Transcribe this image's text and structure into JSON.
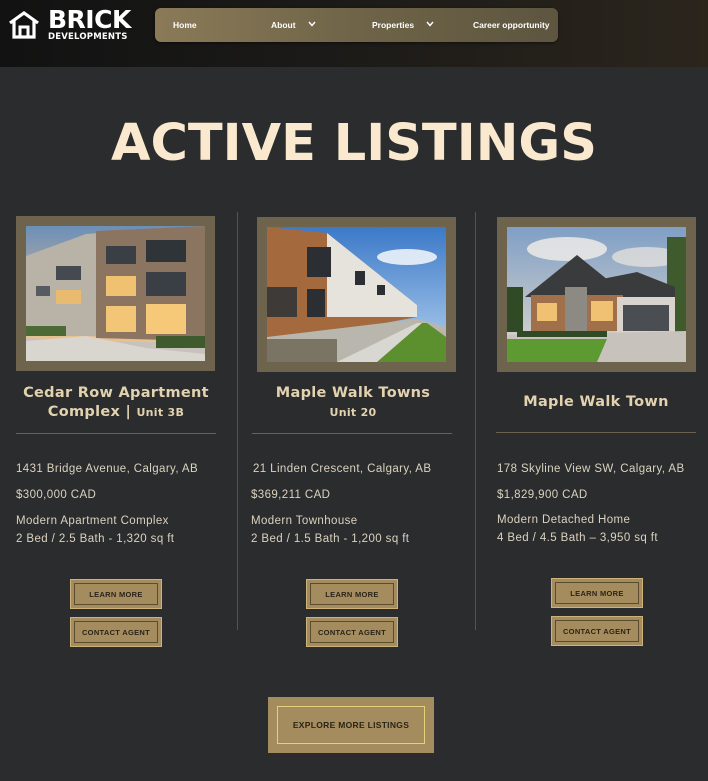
{
  "brand": {
    "name": "BRICK",
    "subtitle": "DEVELOPMENTS",
    "icon": "house-logo-icon"
  },
  "nav": {
    "items": [
      {
        "label": "Home",
        "dropdown": false
      },
      {
        "label": "About",
        "dropdown": true
      },
      {
        "label": "Properties",
        "dropdown": true
      },
      {
        "label": "Career opportunity",
        "dropdown": false
      }
    ]
  },
  "page": {
    "title": "ACTIVE LISTINGS"
  },
  "listings": [
    {
      "name": "Cedar Row Apartment Complex",
      "unit": "Unit 3B",
      "address": "1431 Bridge Avenue, Calgary, AB",
      "price": "$300,000 CAD",
      "type": "Modern Apartment Complex",
      "specs": "2 Bed / 2.5 Bath - 1,320 sq ft",
      "learn_more": "LEARN MORE",
      "contact": "CONTACT AGENT"
    },
    {
      "name": "Maple Walk Towns",
      "unit": "Unit 20",
      "address": "21 Linden Crescent, Calgary, AB",
      "price": "$369,211 CAD",
      "type": "Modern Townhouse",
      "specs": "2 Bed / 1.5 Bath - 1,200 sq ft",
      "learn_more": "LEARN MORE",
      "contact": "CONTACT AGENT"
    },
    {
      "name": "Maple Walk Town",
      "unit": "",
      "address": "178 Skyline View SW, Calgary, AB",
      "price": "$1,829,900 CAD",
      "type": "Modern Detached Home",
      "specs": "4 Bed / 4.5 Bath – 3,950 sq ft",
      "learn_more": "LEARN MORE",
      "contact": "CONTACT AGENT"
    }
  ],
  "explore": {
    "label": "EXPLORE MORE LISTINGS"
  },
  "colors": {
    "background": "#2a2c2d",
    "accent_gold": "#a48c5e",
    "title_cream": "#fbe9cf"
  }
}
